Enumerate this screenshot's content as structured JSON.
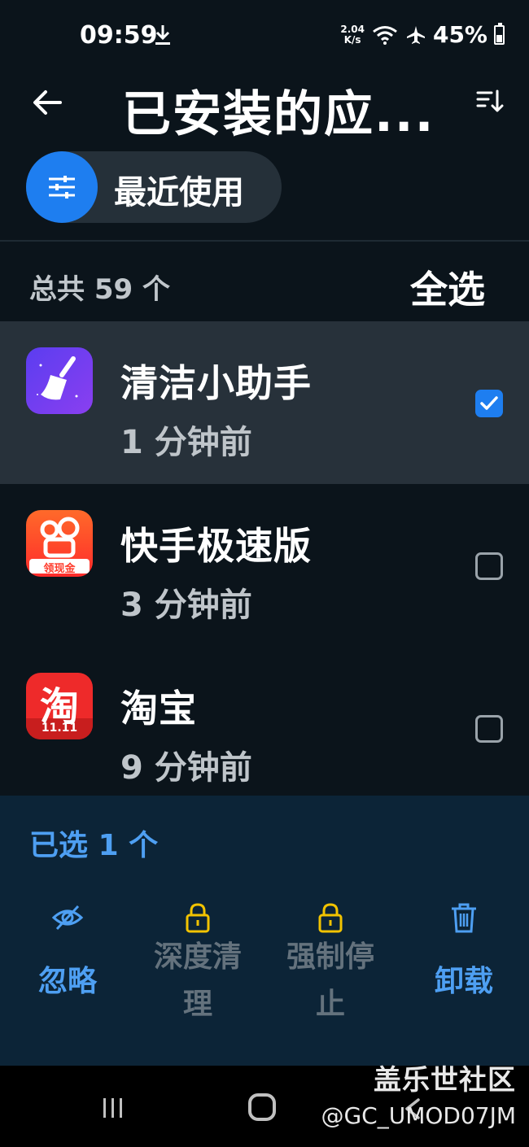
{
  "status": {
    "time": "09:59",
    "speed_top": "2.04",
    "speed_bottom": "K/s",
    "battery": "45%"
  },
  "header": {
    "title": "已安装的应...",
    "back": "back",
    "sort": "sort"
  },
  "filter": {
    "label": "最近使用"
  },
  "summary": {
    "prefix": "总共",
    "count": "59",
    "suffix": "个",
    "select_all": "全选"
  },
  "apps": [
    {
      "name": "清洁小助手",
      "time": "1 分钟前",
      "checked": true
    },
    {
      "name": "快手极速版",
      "time": "3 分钟前",
      "checked": false,
      "badge": "领现金"
    },
    {
      "name": "淘宝",
      "time": "9 分钟前",
      "checked": false,
      "badge_big": "淘",
      "badge_small": "11.11"
    }
  ],
  "bottom": {
    "selected_prefix": "已选",
    "selected_count": "1",
    "selected_suffix": "个",
    "actions": [
      {
        "icon": "eye-off-icon",
        "line1": "忽略",
        "line2": ""
      },
      {
        "icon": "lock-icon",
        "line1": "深度清",
        "line2": "理"
      },
      {
        "icon": "lock-icon",
        "line1": "强制停",
        "line2": "止"
      },
      {
        "icon": "trash-icon",
        "line1": "卸载",
        "line2": ""
      }
    ]
  },
  "watermark": {
    "line1": "盖乐世社区",
    "line2": "@GC_UMOD07JM"
  },
  "colors": {
    "accent": "#1e7ef0",
    "link": "#4e9ff2",
    "lock": "#f2c300",
    "bg": "#0b141b"
  }
}
